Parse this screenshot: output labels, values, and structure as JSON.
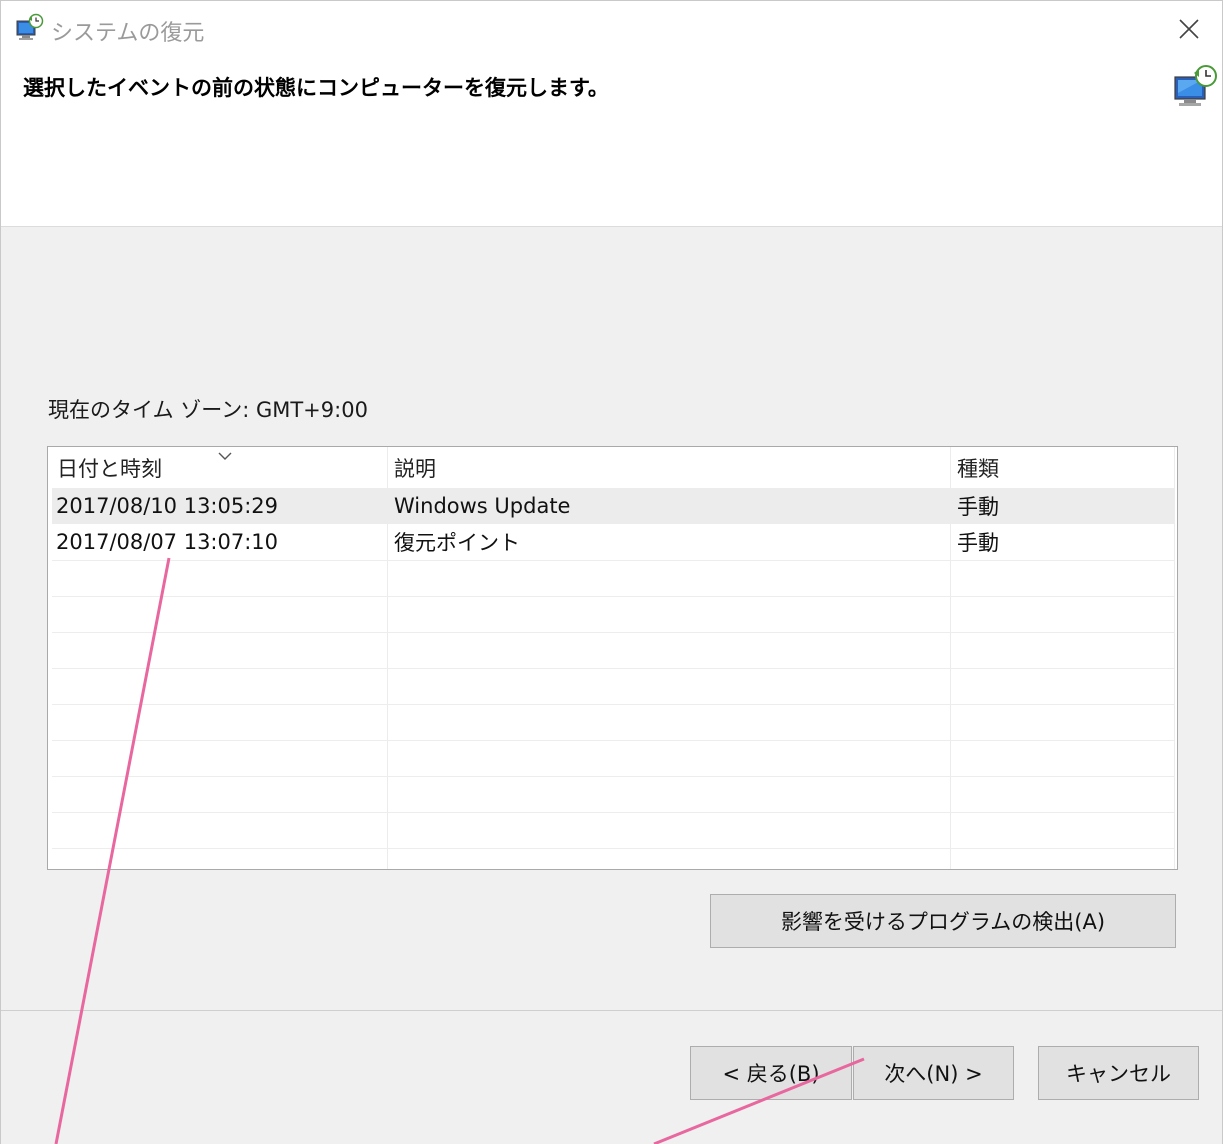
{
  "window": {
    "title": "システムの復元",
    "header_text": "選択したイベントの前の状態にコンピューターを復元します。"
  },
  "timezone_label": "現在のタイム ゾーン: GMT+9:00",
  "table": {
    "columns": [
      "日付と時刻",
      "説明",
      "種類"
    ],
    "rows": [
      {
        "date": "2017/08/10 13:05:29",
        "description": "Windows Update",
        "type": "手動",
        "selected": true
      },
      {
        "date": "2017/08/07 13:07:10",
        "description": "復元ポイント",
        "type": "手動",
        "selected": false
      }
    ]
  },
  "buttons": {
    "scan": "影響を受けるプログラムの検出(A)",
    "back": "< 戻る(B)",
    "next": "次へ(N) >",
    "cancel": "キャンセル"
  },
  "colors": {
    "annotation_line": "#e8679f",
    "selected_row": "#ececec"
  }
}
